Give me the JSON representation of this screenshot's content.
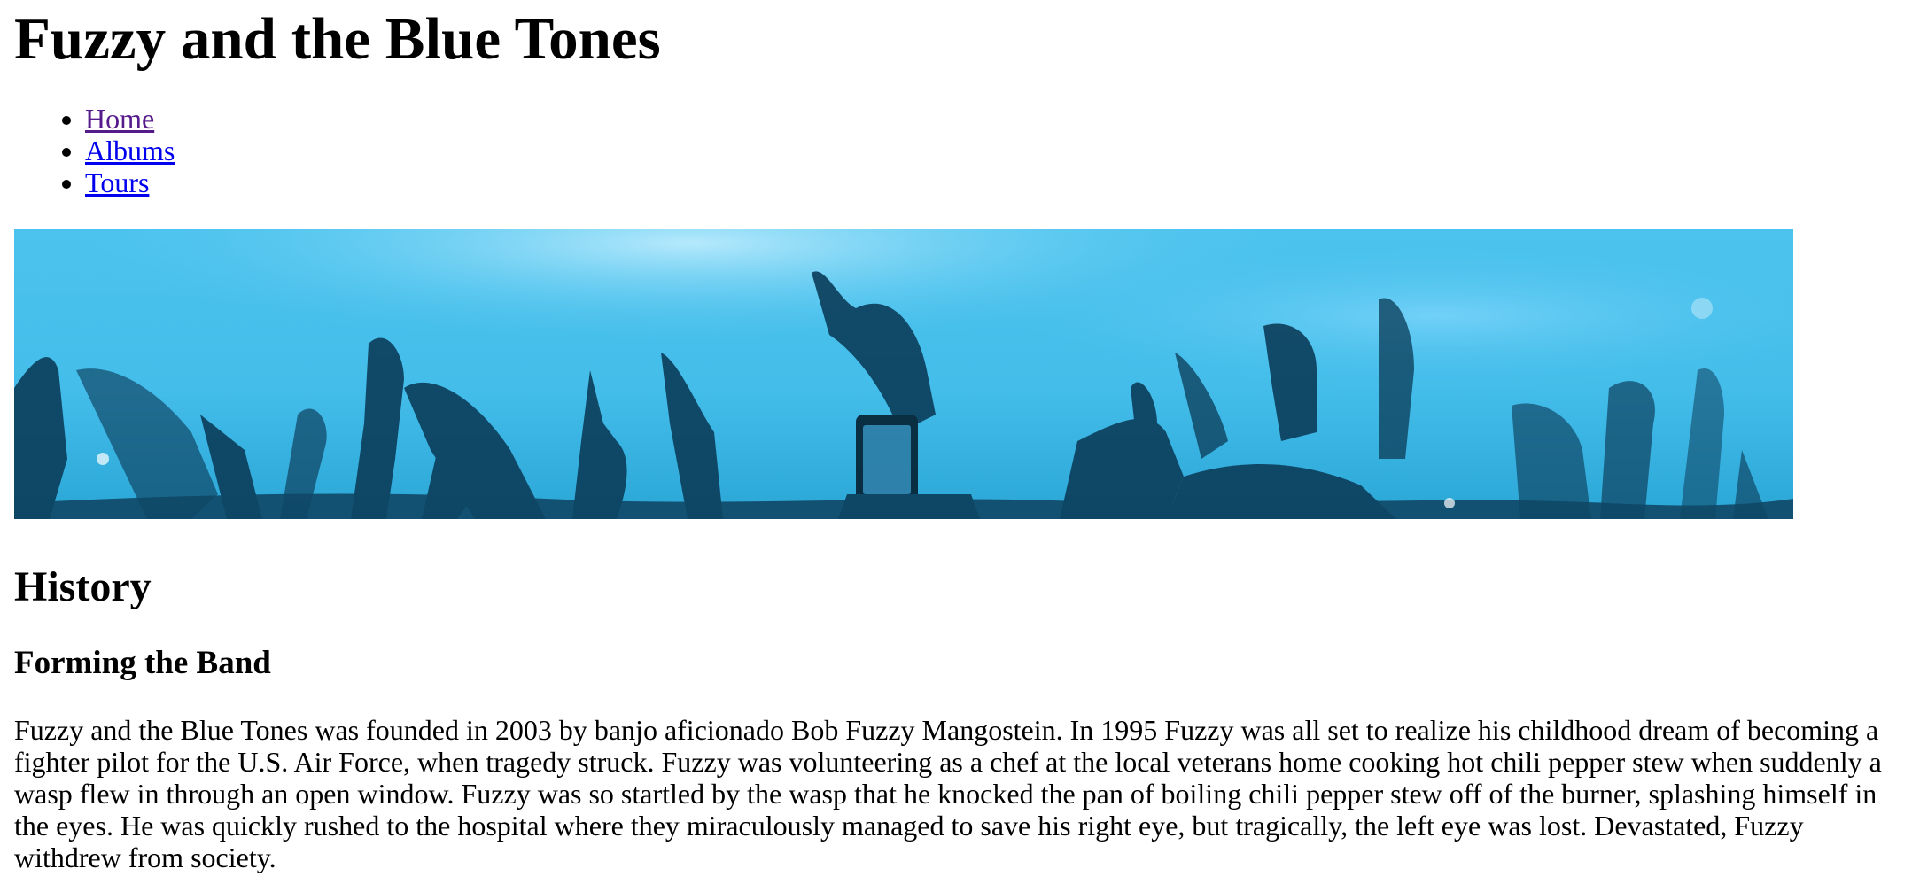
{
  "site": {
    "title": "Fuzzy and the Blue Tones"
  },
  "nav": {
    "items": [
      {
        "label": "Home",
        "state": "visited"
      },
      {
        "label": "Albums",
        "state": "unvisited"
      },
      {
        "label": "Tours",
        "state": "unvisited"
      }
    ]
  },
  "banner": {
    "icon": "concert-crowd-image",
    "tint_color": "#4cc3ee",
    "silhouette_color": "#0b3a55"
  },
  "content": {
    "section_title": "History",
    "subsection_title": "Forming the Band",
    "paragraph": "Fuzzy and the Blue Tones was founded in 2003 by banjo aficionado Bob Fuzzy Mangostein. In 1995 Fuzzy was all set to realize his childhood dream of becoming a fighter pilot for the U.S. Air Force, when tragedy struck. Fuzzy was volunteering as a chef at the local veterans home cooking hot chili pepper stew when suddenly a wasp flew in through an open window. Fuzzy was so startled by the wasp that he knocked the pan of boiling chili pepper stew off of the burner, splashing himself in the eyes. He was quickly rushed to the hospital where they miraculously managed to save his right eye, but tragically, the left eye was lost. Devastated, Fuzzy withdrew from society."
  }
}
